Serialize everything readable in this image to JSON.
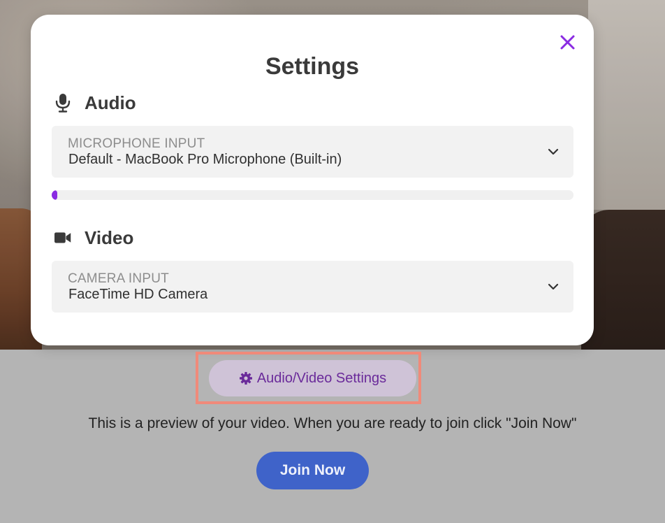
{
  "modal": {
    "title": "Settings",
    "close_icon": "close-icon",
    "audio": {
      "heading": "Audio",
      "icon": "microphone-icon",
      "select_caption": "MICROPHONE INPUT",
      "select_value": "Default - MacBook Pro Microphone (Built-in)",
      "level_fraction": 0.01
    },
    "video": {
      "heading": "Video",
      "icon": "video-camera-icon",
      "select_caption": "CAMERA INPUT",
      "select_value": "FaceTime HD Camera"
    }
  },
  "footer": {
    "av_settings_label": "Audio/Video Settings",
    "av_settings_icon": "gear-icon",
    "preview_message": "This is a preview of your video. When you are ready to join click \"Join Now\"",
    "join_label": "Join Now"
  },
  "colors": {
    "accent_purple": "#8a2be2",
    "join_blue": "#3f63c9",
    "highlight": "#f08a7a"
  }
}
